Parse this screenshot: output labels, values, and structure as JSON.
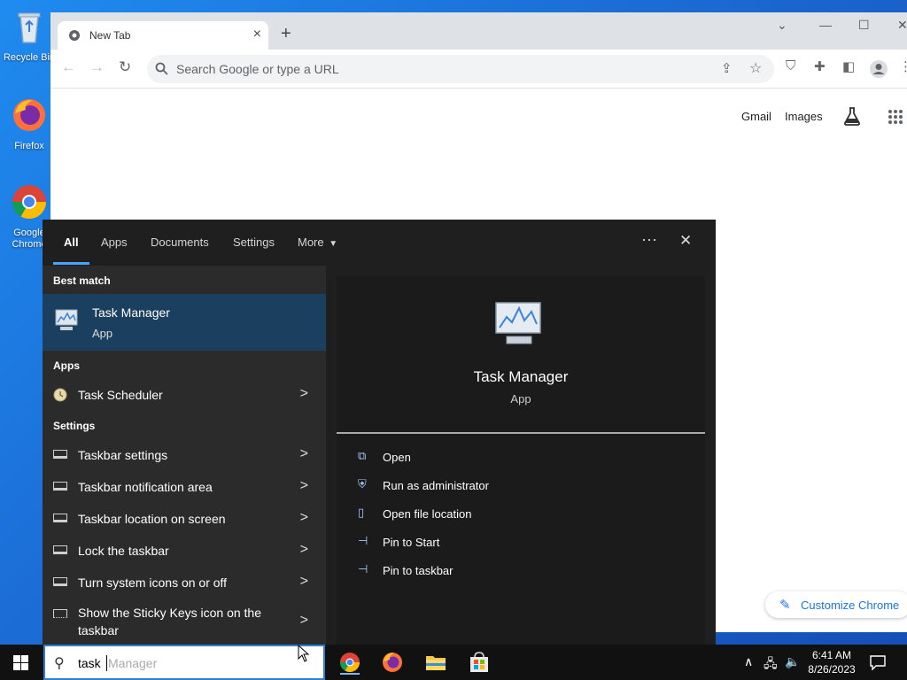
{
  "desktop": {
    "icons": [
      {
        "label": "Recycle Bin"
      },
      {
        "label": "Firefox"
      },
      {
        "label": "Google Chrome"
      }
    ]
  },
  "browser": {
    "tab_title": "New Tab",
    "omnibox_placeholder": "Search Google or type a URL",
    "links": {
      "gmail": "Gmail",
      "images": "Images"
    },
    "customize_label": "Customize Chrome"
  },
  "search_panel": {
    "tabs": [
      {
        "label": "All",
        "active": true
      },
      {
        "label": "Apps"
      },
      {
        "label": "Documents"
      },
      {
        "label": "Settings"
      },
      {
        "label": "More"
      }
    ],
    "sections": {
      "best_match": "Best match",
      "apps": "Apps",
      "settings": "Settings"
    },
    "best_match": {
      "name": "Task Manager",
      "type": "App"
    },
    "apps": [
      {
        "label": "Task Scheduler"
      }
    ],
    "settings": [
      {
        "label": "Taskbar settings"
      },
      {
        "label": "Taskbar notification area"
      },
      {
        "label": "Taskbar location on screen"
      },
      {
        "label": "Lock the taskbar"
      },
      {
        "label": "Turn system icons on or off"
      },
      {
        "label": "Show the Sticky Keys icon on the taskbar"
      }
    ],
    "preview": {
      "name": "Task Manager",
      "type": "App"
    },
    "actions": [
      {
        "label": "Open"
      },
      {
        "label": "Run as administrator"
      },
      {
        "label": "Open file location"
      },
      {
        "label": "Pin to Start"
      },
      {
        "label": "Pin to taskbar"
      }
    ]
  },
  "taskbar": {
    "search_typed": "task",
    "search_suggestion": "Manager",
    "time": "6:41 AM",
    "date": "8/26/2023"
  },
  "colors": {
    "accent": "#4aa3ff",
    "best_match_bg": "#1b3f5f",
    "panel_bg": "#1f1f1f"
  }
}
